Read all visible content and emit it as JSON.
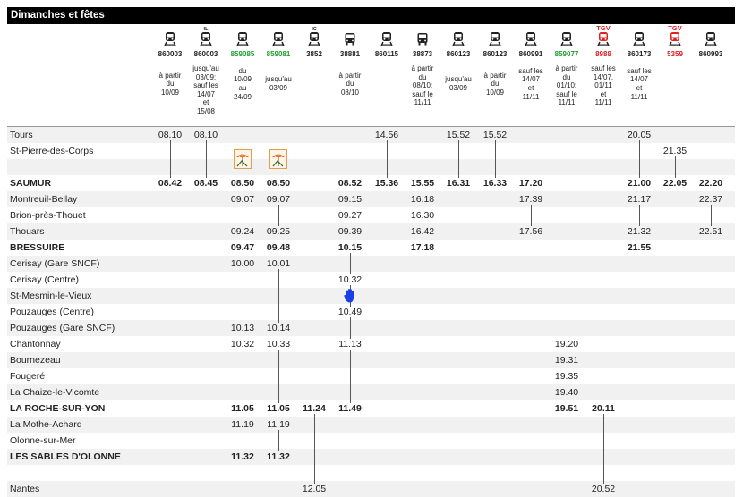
{
  "page_title": "Dimanches et fêtes",
  "colors": {
    "green": "#1e9e2e",
    "red": "#e02020",
    "black": "#222222",
    "stripe": "#f1f1f1",
    "hand": "#1a3fe6"
  },
  "columns": [
    {
      "icon": "train-icon",
      "badge": "",
      "number": "860003",
      "color": "black",
      "note": "à partir\ndu\n10/09"
    },
    {
      "icon": "train-icon",
      "badge": "IL",
      "number": "860003",
      "color": "black",
      "note": "jusqu'au\n03/09;\nsauf les\n14/07\net\n15/08"
    },
    {
      "icon": "train-icon",
      "badge": "",
      "number": "859085",
      "color": "green",
      "note": "du\n10/09\nau\n24/09"
    },
    {
      "icon": "train-icon",
      "badge": "",
      "number": "859081",
      "color": "green",
      "note": "jusqu'au\n03/09"
    },
    {
      "icon": "train-icon",
      "badge": "IC",
      "number": "3852",
      "color": "black",
      "note": ""
    },
    {
      "icon": "bus-icon",
      "badge": "",
      "number": "38881",
      "color": "black",
      "note": "à partir\ndu\n08/10"
    },
    {
      "icon": "train-icon",
      "badge": "",
      "number": "860115",
      "color": "black",
      "note": ""
    },
    {
      "icon": "bus-icon",
      "badge": "",
      "number": "38873",
      "color": "black",
      "note": "à partir\ndu\n08/10;\nsauf le\n11/11"
    },
    {
      "icon": "train-icon",
      "badge": "",
      "number": "860123",
      "color": "black",
      "note": "jusqu'au\n03/09"
    },
    {
      "icon": "train-icon",
      "badge": "",
      "number": "860123",
      "color": "black",
      "note": "à partir\ndu\n10/09"
    },
    {
      "icon": "train-icon",
      "badge": "",
      "number": "860991",
      "color": "black",
      "note": "sauf les\n14/07\net\n11/11"
    },
    {
      "icon": "train-icon",
      "badge": "",
      "number": "859077",
      "color": "green",
      "note": "à partir\ndu\n01/10;\nsauf le\n11/11"
    },
    {
      "icon": "tgv-icon",
      "badge": "TGV",
      "number": "8988",
      "color": "red",
      "note": "sauf les\n14/07,\n01/11\net\n11/11"
    },
    {
      "icon": "train-icon",
      "badge": "",
      "number": "860173",
      "color": "black",
      "note": "sauf les\n14/07\net\n11/11"
    },
    {
      "icon": "tgv-icon",
      "badge": "TGV",
      "number": "5359",
      "color": "red",
      "note": ""
    },
    {
      "icon": "train-icon",
      "badge": "",
      "number": "860993",
      "color": "black",
      "note": ""
    }
  ],
  "stations": [
    {
      "name": "Tours",
      "major": false,
      "times": [
        "08.10",
        "08.10",
        "",
        "",
        "",
        "",
        "14.56",
        "",
        "15.52",
        "15.52",
        "",
        "",
        "",
        "20.05",
        "",
        ""
      ]
    },
    {
      "name": "St-Pierre-des-Corps",
      "major": false,
      "times": [
        "",
        "",
        "",
        "",
        "",
        "",
        "",
        "",
        "",
        "",
        "",
        "",
        "",
        "",
        "21.35",
        ""
      ]
    },
    {
      "name": "",
      "major": false,
      "times": [
        "",
        "",
        "",
        "",
        "",
        "",
        "",
        "",
        "",
        "",
        "",
        "",
        "",
        "",
        "",
        ""
      ]
    },
    {
      "name": "SAUMUR",
      "major": true,
      "times": [
        "08.42",
        "08.45",
        "08.50",
        "08.50",
        "",
        "08.52",
        "15.36",
        "15.55",
        "16.31",
        "16.33",
        "17.20",
        "",
        "",
        "21.00",
        "22.05",
        "22.20"
      ]
    },
    {
      "name": "Montreuil-Bellay",
      "major": false,
      "times": [
        "",
        "",
        "09.07",
        "09.07",
        "",
        "09.15",
        "",
        "16.18",
        "",
        "",
        "17.39",
        "",
        "",
        "21.17",
        "",
        "22.37"
      ]
    },
    {
      "name": "Brion-près-Thouet",
      "major": false,
      "times": [
        "",
        "",
        "",
        "",
        "",
        "09.27",
        "",
        "16.30",
        "",
        "",
        "",
        "",
        "",
        "",
        "",
        ""
      ]
    },
    {
      "name": "Thouars",
      "major": false,
      "times": [
        "",
        "",
        "09.24",
        "09.25",
        "",
        "09.39",
        "",
        "16.42",
        "",
        "",
        "17.56",
        "",
        "",
        "21.32",
        "",
        "22.51"
      ]
    },
    {
      "name": "BRESSUIRE",
      "major": true,
      "times": [
        "",
        "",
        "09.47",
        "09.48",
        "",
        "10.15",
        "",
        "17.18",
        "",
        "",
        "",
        "",
        "",
        "21.55",
        "",
        ""
      ]
    },
    {
      "name": "Cerisay (Gare SNCF)",
      "major": false,
      "times": [
        "",
        "",
        "10.00",
        "10.01",
        "",
        "",
        "",
        "",
        "",
        "",
        "",
        "",
        "",
        "",
        "",
        ""
      ]
    },
    {
      "name": "Cerisay (Centre)",
      "major": false,
      "times": [
        "",
        "",
        "",
        "",
        "",
        "10.32",
        "",
        "",
        "",
        "",
        "",
        "",
        "",
        "",
        "",
        ""
      ]
    },
    {
      "name": "St-Mesmin-le-Vieux",
      "major": false,
      "times": [
        "",
        "",
        "",
        "",
        "",
        "",
        "",
        "",
        "",
        "",
        "",
        "",
        "",
        "",
        "",
        ""
      ]
    },
    {
      "name": "Pouzauges (Centre)",
      "major": false,
      "times": [
        "",
        "",
        "",
        "",
        "",
        "10.49",
        "",
        "",
        "",
        "",
        "",
        "",
        "",
        "",
        "",
        ""
      ]
    },
    {
      "name": "Pouzauges (Gare SNCF)",
      "major": false,
      "times": [
        "",
        "",
        "10.13",
        "10.14",
        "",
        "",
        "",
        "",
        "",
        "",
        "",
        "",
        "",
        "",
        "",
        ""
      ]
    },
    {
      "name": "Chantonnay",
      "major": false,
      "times": [
        "",
        "",
        "10.32",
        "10.33",
        "",
        "11.13",
        "",
        "",
        "",
        "",
        "",
        "19.20",
        "",
        "",
        "",
        ""
      ]
    },
    {
      "name": "Bournezeau",
      "major": false,
      "times": [
        "",
        "",
        "",
        "",
        "",
        "",
        "",
        "",
        "",
        "",
        "",
        "19.31",
        "",
        "",
        "",
        ""
      ]
    },
    {
      "name": "Fougeré",
      "major": false,
      "times": [
        "",
        "",
        "",
        "",
        "",
        "",
        "",
        "",
        "",
        "",
        "",
        "19.35",
        "",
        "",
        "",
        ""
      ]
    },
    {
      "name": "La Chaize-le-Vicomte",
      "major": false,
      "times": [
        "",
        "",
        "",
        "",
        "",
        "",
        "",
        "",
        "",
        "",
        "",
        "19.40",
        "",
        "",
        "",
        ""
      ]
    },
    {
      "name": "LA ROCHE-SUR-YON",
      "major": true,
      "times": [
        "",
        "",
        "11.05",
        "11.05",
        "11.24",
        "11.49",
        "",
        "",
        "",
        "",
        "",
        "19.51",
        "20.11",
        "",
        "",
        ""
      ]
    },
    {
      "name": "La Mothe-Achard",
      "major": false,
      "times": [
        "",
        "",
        "11.19",
        "11.19",
        "",
        "",
        "",
        "",
        "",
        "",
        "",
        "",
        "",
        "",
        "",
        ""
      ]
    },
    {
      "name": "Olonne-sur-Mer",
      "major": false,
      "times": [
        "",
        "",
        "",
        "",
        "",
        "",
        "",
        "",
        "",
        "",
        "",
        "",
        "",
        "",
        "",
        ""
      ]
    },
    {
      "name": "LES SABLES D'OLONNE",
      "major": true,
      "times": [
        "",
        "",
        "11.32",
        "11.32",
        "",
        "",
        "",
        "",
        "",
        "",
        "",
        "",
        "",
        "",
        "",
        ""
      ]
    },
    {
      "name": "",
      "major": false,
      "times": [
        "",
        "",
        "",
        "",
        "",
        "",
        "",
        "",
        "",
        "",
        "",
        "",
        "",
        "",
        "",
        ""
      ]
    },
    {
      "name": "Nantes",
      "major": false,
      "times": [
        "",
        "",
        "",
        "",
        "12.05",
        "",
        "",
        "",
        "",
        "",
        "",
        "",
        "20.52",
        "",
        "",
        ""
      ]
    }
  ]
}
